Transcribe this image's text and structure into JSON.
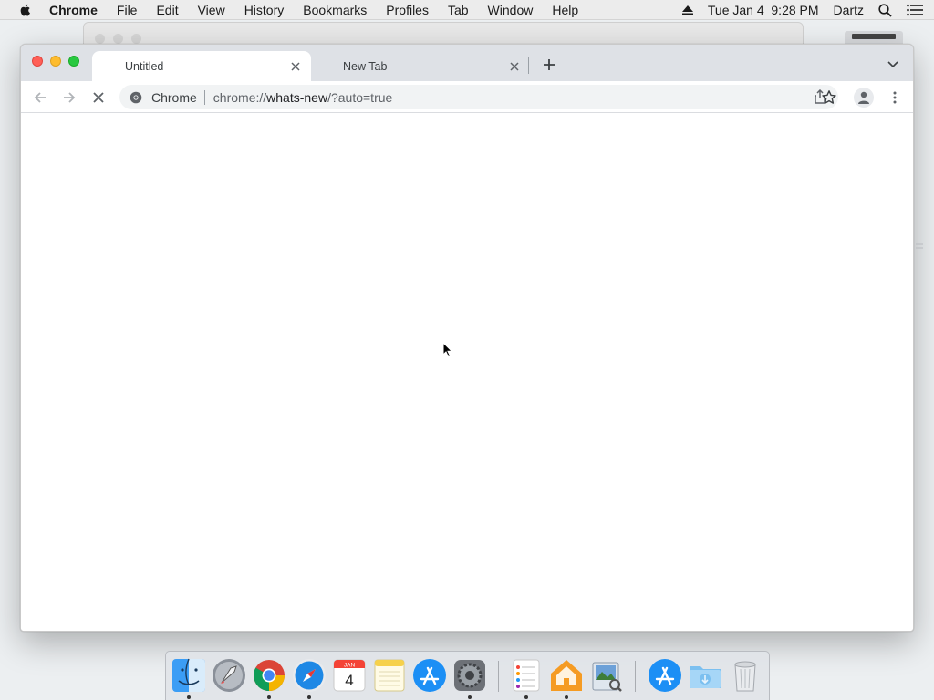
{
  "menubar": {
    "app_name": "Chrome",
    "items": [
      "File",
      "Edit",
      "View",
      "History",
      "Bookmarks",
      "Profiles",
      "Tab",
      "Window",
      "Help"
    ],
    "clock": "Tue Jan 4  9:28 PM",
    "user": "Dartz"
  },
  "browser": {
    "tabs": [
      {
        "title": "Untitled",
        "active": true
      },
      {
        "title": "New Tab",
        "active": false
      }
    ],
    "omnibox": {
      "chip_label": "Chrome",
      "url_scheme": "chrome://",
      "url_host": "whats-new",
      "url_rest": "/?auto=true"
    },
    "loading": true
  },
  "dock": {
    "calendar_month": "JAN",
    "calendar_day": "4",
    "items": [
      {
        "name": "finder-icon",
        "running": true
      },
      {
        "name": "launchpad-icon",
        "running": false
      },
      {
        "name": "chrome-icon",
        "running": true
      },
      {
        "name": "safari-icon",
        "running": true
      },
      {
        "name": "calendar-icon",
        "running": false
      },
      {
        "name": "notes-icon",
        "running": false
      },
      {
        "name": "app-store-icon",
        "running": false
      },
      {
        "name": "system-preferences-icon",
        "running": true
      },
      {
        "name": "reminders-icon",
        "running": true
      },
      {
        "name": "home-icon",
        "running": true
      },
      {
        "name": "preview-icon",
        "running": false
      },
      {
        "name": "app-store-downloads-icon",
        "running": false
      },
      {
        "name": "downloads-folder-icon",
        "running": false
      },
      {
        "name": "trash-icon",
        "running": false
      }
    ]
  },
  "colors": {
    "tabstrip": "#dee1e6",
    "omnibox": "#f1f3f4",
    "close": "#ff5f57",
    "minimize": "#febc2e",
    "maximize": "#28c840"
  }
}
